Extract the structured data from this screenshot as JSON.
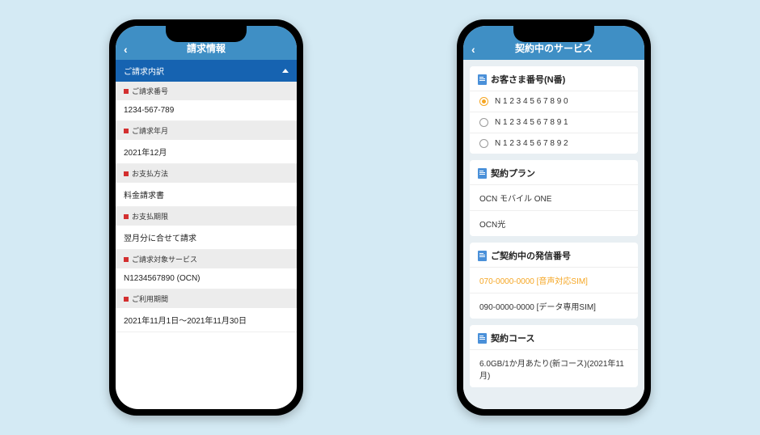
{
  "phone1": {
    "headerTitle": "請求情報",
    "sectionTitle": "ご請求内訳",
    "rows": [
      {
        "label": "ご請求番号",
        "value": "1234-567-789"
      },
      {
        "label": "ご請求年月",
        "value": "2021年12月"
      },
      {
        "label": "お支払方法",
        "value": "料金請求書"
      },
      {
        "label": "お支払期限",
        "value": "翌月分に合せて請求"
      },
      {
        "label": "ご請求対象サービス",
        "value": "N1234567890 (OCN)"
      },
      {
        "label": "ご利用期間",
        "value": "2021年11月1日～2021年11月30日"
      }
    ]
  },
  "phone2": {
    "headerTitle": "契約中のサービス",
    "customerSection": {
      "title": "お客さま番号(N番)",
      "options": [
        {
          "value": "N 1 2 3 4 5 6 7 8 9 0",
          "checked": true
        },
        {
          "value": "N 1 2 3 4 5 6 7 8 9 1",
          "checked": false
        },
        {
          "value": "N 1 2 3 4 5 6 7 8 9 2",
          "checked": false
        }
      ]
    },
    "planSection": {
      "title": "契約プラン",
      "items": [
        "OCN モバイル ONE",
        "OCN光"
      ]
    },
    "callSection": {
      "title": "ご契約中の発信番号",
      "items": [
        {
          "text": "070-0000-0000 [音声対応SIM]",
          "highlight": true
        },
        {
          "text": "090-0000-0000 [データ専用SIM]",
          "highlight": false
        }
      ]
    },
    "courseSection": {
      "title": "契約コース",
      "items": [
        "6.0GB/1か月あたり(新コース)(2021年11月)"
      ]
    }
  }
}
